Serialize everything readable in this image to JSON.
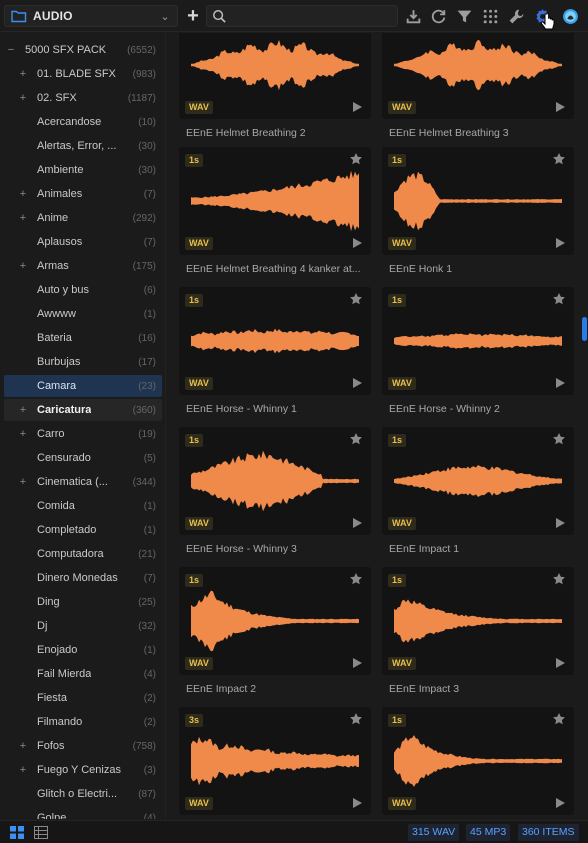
{
  "toolbar": {
    "folder_label": "AUDIO",
    "search_placeholder": "",
    "search_value": "",
    "icons": [
      "folder-icon",
      "chevron-down-icon",
      "plus-icon",
      "search-icon",
      "download-icon",
      "refresh-icon",
      "filter-icon",
      "grid-dots-icon",
      "wrench-icon",
      "settings-gear-icon",
      "eagle-app-icon"
    ]
  },
  "sidebar": {
    "items": [
      {
        "label": "5000 SFX PACK",
        "count": "(6552)",
        "expander": "−",
        "level": 0
      },
      {
        "label": "01. BLADE SFX",
        "count": "(983)",
        "expander": "+",
        "level": 1
      },
      {
        "label": "02. SFX",
        "count": "(1187)",
        "expander": "+",
        "level": 1
      },
      {
        "label": "Acercandose",
        "count": "(10)",
        "expander": "",
        "level": 1
      },
      {
        "label": "Alertas, Error, ...",
        "count": "(30)",
        "expander": "",
        "level": 1
      },
      {
        "label": "Ambiente",
        "count": "(30)",
        "expander": "",
        "level": 1
      },
      {
        "label": "Animales",
        "count": "(7)",
        "expander": "+",
        "level": 1
      },
      {
        "label": "Anime",
        "count": "(292)",
        "expander": "+",
        "level": 1
      },
      {
        "label": "Aplausos",
        "count": "(7)",
        "expander": "",
        "level": 1
      },
      {
        "label": "Armas",
        "count": "(175)",
        "expander": "+",
        "level": 1
      },
      {
        "label": "Auto y bus",
        "count": "(6)",
        "expander": "",
        "level": 1
      },
      {
        "label": "Awwww",
        "count": "(1)",
        "expander": "",
        "level": 1
      },
      {
        "label": "Bateria",
        "count": "(16)",
        "expander": "",
        "level": 1
      },
      {
        "label": "Burbujas",
        "count": "(17)",
        "expander": "",
        "level": 1
      },
      {
        "label": "Camara",
        "count": "(23)",
        "expander": "",
        "level": 1,
        "state": "selected"
      },
      {
        "label": "Caricatura",
        "count": "(360)",
        "expander": "+",
        "level": 1,
        "state": "hover"
      },
      {
        "label": "Carro",
        "count": "(19)",
        "expander": "+",
        "level": 1
      },
      {
        "label": "Censurado",
        "count": "(5)",
        "expander": "",
        "level": 1
      },
      {
        "label": "Cinematica (...",
        "count": "(344)",
        "expander": "+",
        "level": 1
      },
      {
        "label": "Comida",
        "count": "(1)",
        "expander": "",
        "level": 1
      },
      {
        "label": "Completado",
        "count": "(1)",
        "expander": "",
        "level": 1
      },
      {
        "label": "Computadora",
        "count": "(21)",
        "expander": "",
        "level": 1
      },
      {
        "label": "Dinero Monedas",
        "count": "(7)",
        "expander": "",
        "level": 1
      },
      {
        "label": "Ding",
        "count": "(25)",
        "expander": "",
        "level": 1
      },
      {
        "label": "Dj",
        "count": "(32)",
        "expander": "",
        "level": 1
      },
      {
        "label": "Enojado",
        "count": "(1)",
        "expander": "",
        "level": 1
      },
      {
        "label": "Fail Mierda",
        "count": "(4)",
        "expander": "",
        "level": 1
      },
      {
        "label": "Fiesta",
        "count": "(2)",
        "expander": "",
        "level": 1
      },
      {
        "label": "Filmando",
        "count": "(2)",
        "expander": "",
        "level": 1
      },
      {
        "label": "Fofos",
        "count": "(758)",
        "expander": "+",
        "level": 1
      },
      {
        "label": "Fuego Y Cenizas",
        "count": "(3)",
        "expander": "+",
        "level": 1
      },
      {
        "label": "Glitch o Electri...",
        "count": "(87)",
        "expander": "",
        "level": 1
      },
      {
        "label": "Golpe",
        "count": "(4)",
        "expander": "",
        "level": 1
      }
    ]
  },
  "cards": [
    {
      "title": "EEnE Helmet Breathing 2",
      "duration": "",
      "format": "WAV",
      "shape": "breath"
    },
    {
      "title": "EEnE Helmet Breathing 3",
      "duration": "",
      "format": "WAV",
      "shape": "breath"
    },
    {
      "title": "EEnE Helmet Breathing 4 kanker at...",
      "duration": "1s",
      "format": "WAV",
      "shape": "rising"
    },
    {
      "title": "EEnE Honk 1",
      "duration": "1s",
      "format": "WAV",
      "shape": "honk"
    },
    {
      "title": "EEnE Horse - Whinny 1",
      "duration": "1s",
      "format": "WAV",
      "shape": "thin"
    },
    {
      "title": "EEnE Horse - Whinny 2",
      "duration": "1s",
      "format": "WAV",
      "shape": "thin2"
    },
    {
      "title": "EEnE Horse - Whinny 3",
      "duration": "1s",
      "format": "WAV",
      "shape": "burst"
    },
    {
      "title": "EEnE Impact 1",
      "duration": "1s",
      "format": "WAV",
      "shape": "diamond"
    },
    {
      "title": "EEnE Impact 2",
      "duration": "1s",
      "format": "WAV",
      "shape": "decay"
    },
    {
      "title": "EEnE Impact 3",
      "duration": "1s",
      "format": "WAV",
      "shape": "decay2"
    },
    {
      "title": "",
      "duration": "3s",
      "format": "WAV",
      "shape": "spiky"
    },
    {
      "title": "",
      "duration": "1s",
      "format": "WAV",
      "shape": "decay3"
    }
  ],
  "statusbar": {
    "wav_count": "315 WAV",
    "mp3_count": "45 MP3",
    "item_count": "360 ITEMS"
  },
  "colors": {
    "accent": "#2c7be5",
    "waveform": "#f08a4b",
    "badge_text": "#e7c04a",
    "selected_row": "#1f3450"
  }
}
